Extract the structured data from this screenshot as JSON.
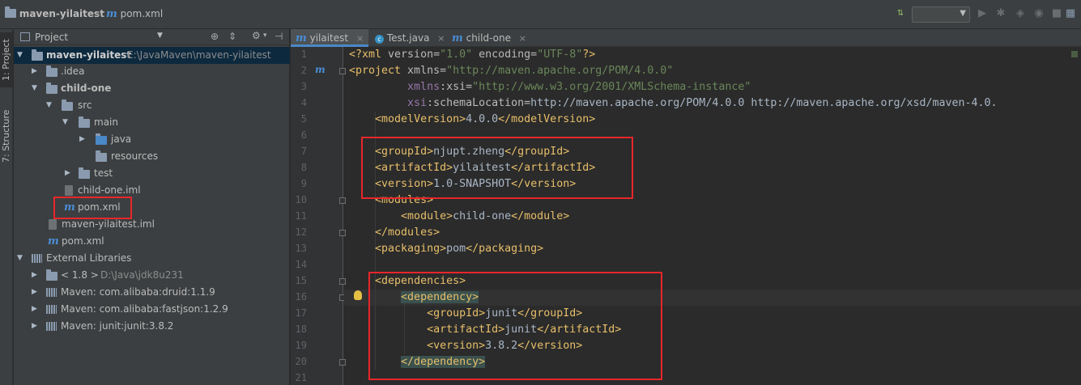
{
  "breadcrumb": {
    "project": "maven-yilaitest",
    "file": "pom.xml"
  },
  "toolbar": {
    "run_config_value": "",
    "icons": [
      "make-project-icon",
      "run-icon",
      "debug-icon",
      "coverage-icon",
      "stop-icon",
      "project-structure-icon"
    ]
  },
  "tool_stripe": {
    "project_tab": "1: Project",
    "structure_tab": "7: Structure"
  },
  "project_panel": {
    "title": "Project",
    "tree": [
      {
        "label": "maven-yilaitest",
        "path": "E:\\JavaMaven\\maven-yilaitest",
        "icon": "module-folder-icon",
        "bold": true
      },
      {
        "label": ".idea",
        "icon": "folder-icon"
      },
      {
        "label": "child-one",
        "icon": "module-folder-icon",
        "bold": true
      },
      {
        "label": "src",
        "icon": "folder-icon"
      },
      {
        "label": "main",
        "icon": "folder-icon"
      },
      {
        "label": "java",
        "icon": "source-folder-icon"
      },
      {
        "label": "resources",
        "icon": "resources-folder-icon"
      },
      {
        "label": "test",
        "icon": "folder-icon"
      },
      {
        "label": "child-one.iml",
        "icon": "iml-file-icon"
      },
      {
        "label": "pom.xml",
        "icon": "maven-file-icon"
      },
      {
        "label": "maven-yilaitest.iml",
        "icon": "iml-file-icon"
      },
      {
        "label": "pom.xml",
        "icon": "maven-file-icon"
      },
      {
        "label": "External Libraries",
        "icon": "libraries-icon"
      },
      {
        "label": "< 1.8 >",
        "path": "D:\\Java\\jdk8u231",
        "icon": "jdk-icon"
      },
      {
        "label": "Maven: com.alibaba:druid:1.1.9",
        "icon": "library-icon"
      },
      {
        "label": "Maven: com.alibaba:fastjson:1.2.9",
        "icon": "library-icon"
      },
      {
        "label": "Maven: junit:junit:3.8.2",
        "icon": "library-icon"
      }
    ]
  },
  "editor": {
    "tabs": [
      {
        "label": "yilaitest",
        "icon": "maven-file-icon",
        "active": true
      },
      {
        "label": "Test.java",
        "icon": "java-class-icon",
        "active": false
      },
      {
        "label": "child-one",
        "icon": "maven-file-icon",
        "active": false
      }
    ],
    "line_numbers": [
      "1",
      "2",
      "3",
      "4",
      "5",
      "6",
      "7",
      "8",
      "9",
      "10",
      "11",
      "12",
      "13",
      "14",
      "15",
      "16",
      "17",
      "18",
      "19",
      "20",
      "21"
    ],
    "code": [
      "<?xml version=\"1.0\" encoding=\"UTF-8\"?>",
      "<project xmlns=\"http://maven.apache.org/POM/4.0.0\"",
      "         xmlns:xsi=\"http://www.w3.org/2001/XMLSchema-instance\"",
      "         xsi:schemaLocation=\"http://maven.apache.org/POM/4.0.0 http://maven.apache.org/xsd/maven-4.0.",
      "    <modelVersion>4.0.0</modelVersion>",
      "",
      "    <groupId>njupt.zheng</groupId>",
      "    <artifactId>yilaitest</artifactId>",
      "    <version>1.0-SNAPSHOT</version>",
      "    <modules>",
      "        <module>child-one</module>",
      "    </modules>",
      "    <packaging>pom</packaging>",
      "",
      "    <dependencies>",
      "        <dependency>",
      "            <groupId>junit</groupId>",
      "            <artifactId>junit</artifactId>",
      "            <version>3.8.2</version>",
      "        </dependency>",
      ""
    ]
  },
  "colors": {
    "highlight_box": "#e8262a",
    "tag": "#e8bf6a",
    "string": "#6a8759",
    "namespace": "#9876aa",
    "selection": "#0d293e"
  }
}
